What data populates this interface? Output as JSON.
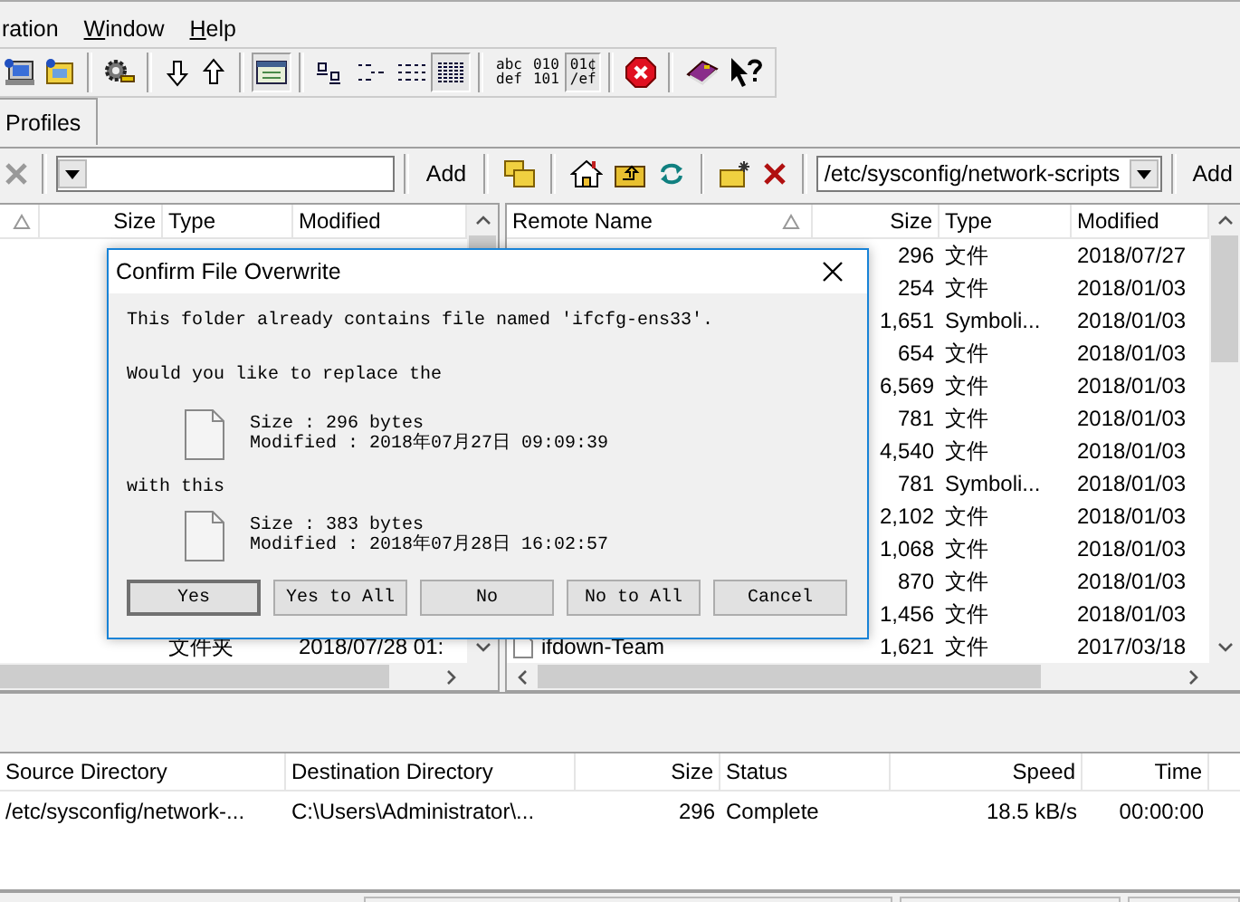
{
  "menu": [
    {
      "label": "ration"
    },
    {
      "label": "Window",
      "mnemonic": true
    },
    {
      "label": "Help",
      "mnemonic": true
    }
  ],
  "toolbar": {
    "log_window_selected": true,
    "view_buttons": [
      {
        "selected": false
      },
      {
        "selected": false
      },
      {
        "selected": false
      },
      {
        "selected": true
      }
    ],
    "transfer_modes": [
      {
        "lines": [
          "abc",
          "def"
        ],
        "selected": false
      },
      {
        "lines": [
          "010",
          "101"
        ],
        "selected": false
      },
      {
        "lines": [
          "01¢",
          "/ef"
        ],
        "selected": true
      }
    ]
  },
  "tabs": [
    {
      "label": "Profiles",
      "selected": true
    }
  ],
  "local": {
    "add_button": "Add",
    "columns": [
      "Size",
      "Type",
      "Modified"
    ],
    "rows": [
      {
        "type": "文件夹",
        "modified": "2018/07/28 01:"
      }
    ]
  },
  "remote": {
    "path": "/etc/sysconfig/network-scripts",
    "add_button": "Add",
    "columns": [
      "Remote Name",
      "Size",
      "Type",
      "Modified"
    ],
    "rows": [
      {
        "size": "296",
        "type": "文件",
        "modified": "2018/07/27"
      },
      {
        "size": "254",
        "type": "文件",
        "modified": "2018/01/03"
      },
      {
        "size": "1,651",
        "type": "Symboli...",
        "modified": "2018/01/03"
      },
      {
        "size": "654",
        "type": "文件",
        "modified": "2018/01/03"
      },
      {
        "size": "6,569",
        "type": "文件",
        "modified": "2018/01/03"
      },
      {
        "size": "781",
        "type": "文件",
        "modified": "2018/01/03"
      },
      {
        "size": "4,540",
        "type": "文件",
        "modified": "2018/01/03"
      },
      {
        "size": "781",
        "type": "Symboli...",
        "modified": "2018/01/03"
      },
      {
        "size": "2,102",
        "type": "文件",
        "modified": "2018/01/03"
      },
      {
        "size": "1,068",
        "type": "文件",
        "modified": "2018/01/03"
      },
      {
        "size": "870",
        "type": "文件",
        "modified": "2018/01/03"
      },
      {
        "size": "1,456",
        "type": "文件",
        "modified": "2018/01/03"
      },
      {
        "name": "ifdown-Team",
        "size": "1,621",
        "type": "文件",
        "modified": "2017/03/18"
      }
    ]
  },
  "dialog": {
    "title": "Confirm File Overwrite",
    "message": "This folder already contains file named 'ifcfg-ens33'.",
    "prompt": "Would you like to replace the",
    "existing": {
      "size": "Size : 296 bytes",
      "modified": "Modified : 2018年07月27日 09:09:39"
    },
    "connector": "with this",
    "incoming": {
      "size": "Size : 383 bytes",
      "modified": "Modified : 2018年07月28日 16:02:57"
    },
    "buttons": [
      {
        "label": "Yes",
        "default": true
      },
      {
        "label": "Yes to All",
        "default": false
      },
      {
        "label": "No",
        "default": false
      },
      {
        "label": "No to All",
        "default": false
      },
      {
        "label": "Cancel",
        "default": false
      }
    ]
  },
  "queue": {
    "columns": [
      "Source Directory",
      "Destination Directory",
      "Size",
      "Status",
      "Speed",
      "Time"
    ],
    "rows": [
      {
        "source": "/etc/sysconfig/network-...",
        "destination": "C:\\Users\\Administrator\\...",
        "size": "296",
        "status": "Complete",
        "speed": "18.5 kB/s",
        "time": "00:00:00"
      }
    ]
  }
}
